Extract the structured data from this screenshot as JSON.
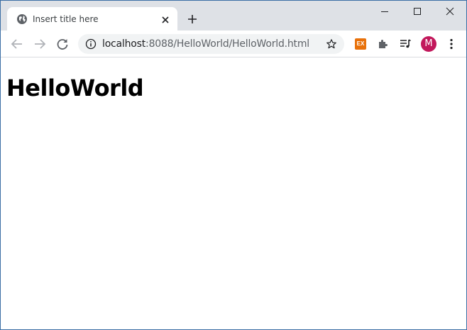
{
  "tab": {
    "title": "Insert title here"
  },
  "address_bar": {
    "host": "localhost",
    "rest": ":8088/HelloWorld/HelloWorld.html"
  },
  "extension_badge": "EX",
  "profile": {
    "initial": "M"
  },
  "page": {
    "heading": "HelloWorld"
  },
  "colors": {
    "tabstrip": "#dee1e6",
    "avatar": "#c2185b",
    "extension": "#e8710a",
    "window_border": "#3b6ea5"
  }
}
